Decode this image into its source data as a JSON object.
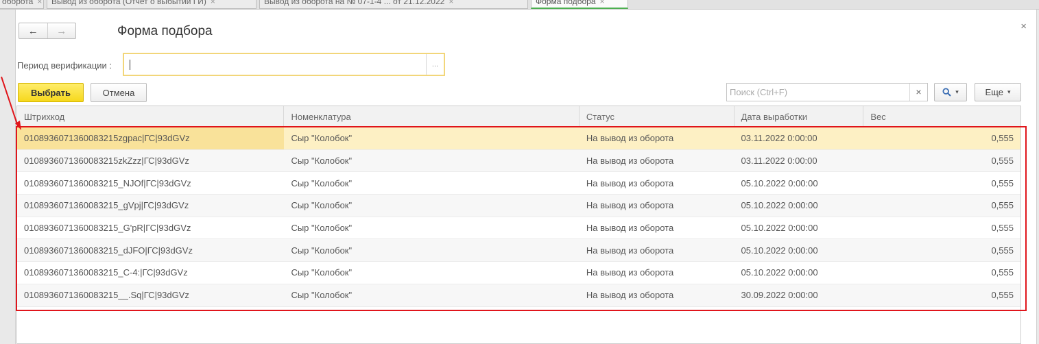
{
  "tabs": [
    {
      "label": "оборота",
      "active": false
    },
    {
      "label": "Вывод из оборота (Отчет о выбытии ГИ)",
      "active": false
    },
    {
      "label": "Вывод из оборота на № 07-1-4 ... от 21.12.2022",
      "active": false
    },
    {
      "label": "Форма подбора",
      "active": true
    }
  ],
  "window": {
    "title": "Форма подбора",
    "nav": {
      "back": "←",
      "forward": "→"
    },
    "close": "×"
  },
  "period": {
    "label": "Период верификации :",
    "value": "",
    "choose": "..."
  },
  "toolbar": {
    "select_label": "Выбрать",
    "cancel_label": "Отмена",
    "search_placeholder": "Поиск (Ctrl+F)",
    "search_clear": "×",
    "search_icon": "search-icon",
    "more_label": "Еще",
    "dropdown_glyph": "▾"
  },
  "table": {
    "columns": [
      "Штрихкод",
      "Номенклатура",
      "Статус",
      "Дата выработки",
      "Вес"
    ],
    "rows": [
      {
        "barcode": "0108936071360083215zgpac|ГС|93dGVz",
        "item": "Сыр \"Колобок\"",
        "status": "На вывод из оборота",
        "date": "03.11.2022 0:00:00",
        "weight": "0,555",
        "selected": true
      },
      {
        "barcode": "0108936071360083215zkZzz|ГС|93dGVz",
        "item": "Сыр \"Колобок\"",
        "status": "На вывод из оборота",
        "date": "03.11.2022 0:00:00",
        "weight": "0,555",
        "selected": false
      },
      {
        "barcode": "0108936071360083215_NJOf|ГС|93dGVz",
        "item": "Сыр \"Колобок\"",
        "status": "На вывод из оборота",
        "date": "05.10.2022 0:00:00",
        "weight": "0,555",
        "selected": false
      },
      {
        "barcode": "0108936071360083215_gVpj|ГС|93dGVz",
        "item": "Сыр \"Колобок\"",
        "status": "На вывод из оборота",
        "date": "05.10.2022 0:00:00",
        "weight": "0,555",
        "selected": false
      },
      {
        "barcode": "0108936071360083215_G'pR|ГС|93dGVz",
        "item": "Сыр \"Колобок\"",
        "status": "На вывод из оборота",
        "date": "05.10.2022 0:00:00",
        "weight": "0,555",
        "selected": false
      },
      {
        "barcode": "0108936071360083215_dJFO|ГС|93dGVz",
        "item": "Сыр \"Колобок\"",
        "status": "На вывод из оборота",
        "date": "05.10.2022 0:00:00",
        "weight": "0,555",
        "selected": false
      },
      {
        "barcode": "0108936071360083215_C-4:|ГС|93dGVz",
        "item": "Сыр \"Колобок\"",
        "status": "На вывод из оборота",
        "date": "05.10.2022 0:00:00",
        "weight": "0,555",
        "selected": false
      },
      {
        "barcode": "0108936071360083215__.Sq|ГС|93dGVz",
        "item": "Сыр \"Колобок\"",
        "status": "На вывод из оборота",
        "date": "30.09.2022 0:00:00",
        "weight": "0,555",
        "selected": false
      }
    ]
  },
  "annotation": {
    "frame_color": "#e0151b"
  },
  "colors": {
    "select_button": "#f6d81c",
    "selected_row": "#fdf0c4",
    "active_tab_underline": "#4caf50"
  }
}
